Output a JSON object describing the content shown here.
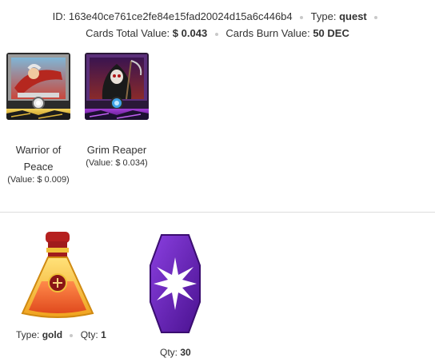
{
  "header": {
    "id_label": "ID:",
    "id_value": "163e40ce761ce2fe84e15fad20024d15a6c446b4",
    "type_label": "Type:",
    "type_value": "quest",
    "total_label": "Cards Total Value:",
    "total_value": "$ 0.043",
    "burn_label": "Cards Burn Value:",
    "burn_value": "50 DEC"
  },
  "cards": [
    {
      "name_line1": "Warrior of",
      "name_line2": "Peace",
      "value": "(Value: $ 0.009)",
      "icon": "warrior-card-art"
    },
    {
      "name": "Grim Reaper",
      "value": "(Value: $ 0.034)",
      "icon": "reaper-card-art"
    }
  ],
  "rewards": [
    {
      "icon": "gold-potion-icon",
      "type_label": "Type:",
      "type_value": "gold",
      "qty_label": "Qty:",
      "qty_value": "1"
    },
    {
      "icon": "purple-crystal-icon",
      "qty_label": "Qty:",
      "qty_value": "30"
    }
  ],
  "colors": {
    "text": "#333333",
    "divider": "#dddddd",
    "potion": "#f5a623",
    "crystal": "#6a1fb5"
  }
}
